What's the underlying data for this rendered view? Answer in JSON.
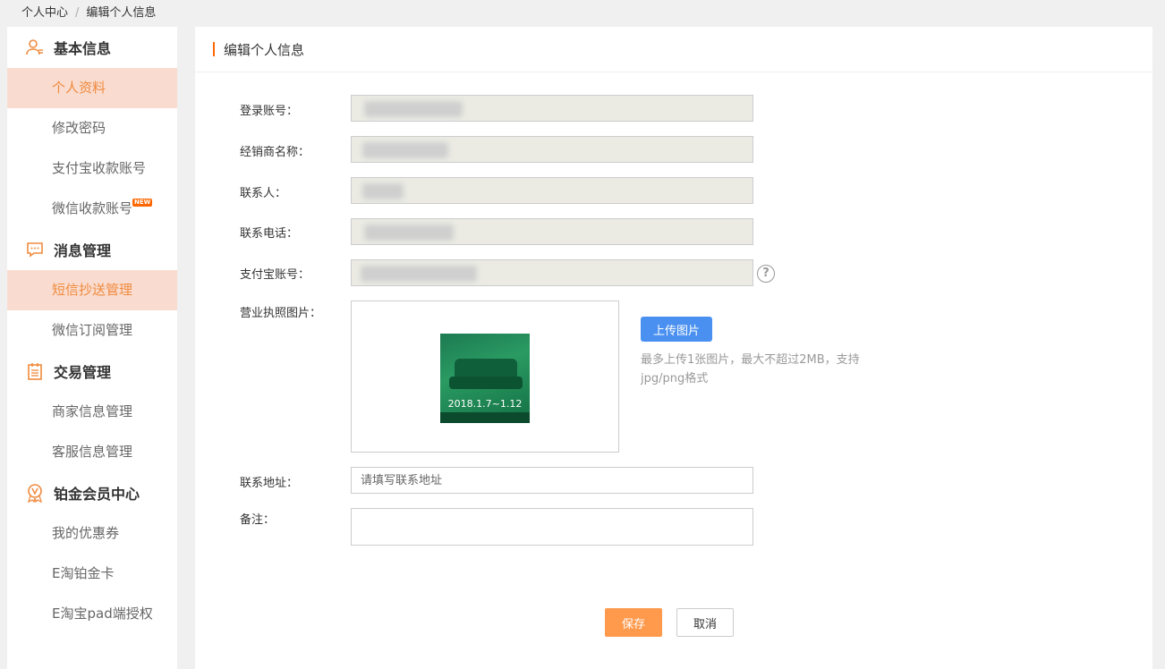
{
  "breadcrumb": {
    "home": "个人中心",
    "separator": "/",
    "current": "编辑个人信息"
  },
  "sidebar": {
    "groups": [
      {
        "title": "基本信息",
        "icon": "user-icon",
        "items": [
          {
            "label": "个人资料",
            "active": true
          },
          {
            "label": "修改密码"
          },
          {
            "label": "支付宝收款账号"
          },
          {
            "label": "微信收款账号",
            "badge": "NEW"
          }
        ]
      },
      {
        "title": "消息管理",
        "icon": "message-icon",
        "items": [
          {
            "label": "短信抄送管理",
            "active": true
          },
          {
            "label": "微信订阅管理"
          }
        ]
      },
      {
        "title": "交易管理",
        "icon": "clipboard-icon",
        "items": [
          {
            "label": "商家信息管理"
          },
          {
            "label": "客服信息管理"
          }
        ]
      },
      {
        "title": "铂金会员中心",
        "icon": "vip-medal-icon",
        "items": [
          {
            "label": "我的优惠券"
          },
          {
            "label": "E淘铂金卡"
          },
          {
            "label": "E淘宝pad端授权"
          }
        ]
      }
    ]
  },
  "main": {
    "title": "编辑个人信息",
    "form": {
      "account_label": "登录账号：",
      "dealer_label": "经销商名称：",
      "contact_label": "联系人：",
      "phone_label": "联系电话：",
      "alipay_label": "支付宝账号：",
      "license_label": "营业执照图片：",
      "address_label": "联系地址：",
      "address_placeholder": "请填写联系地址",
      "notes_label": "备注："
    },
    "license_image_date": "2018.1.7~1.12",
    "upload_label": "上传图片",
    "upload_tip": "最多上传1张图片，最大不超过2MB，支持jpg/png格式",
    "help_glyph": "?",
    "save_label": "保存",
    "cancel_label": "取消"
  },
  "colors": {
    "accent": "#f08a3e",
    "active_bg": "#f9dccf",
    "upload": "#4a90f0",
    "save": "#ff9a4d"
  }
}
